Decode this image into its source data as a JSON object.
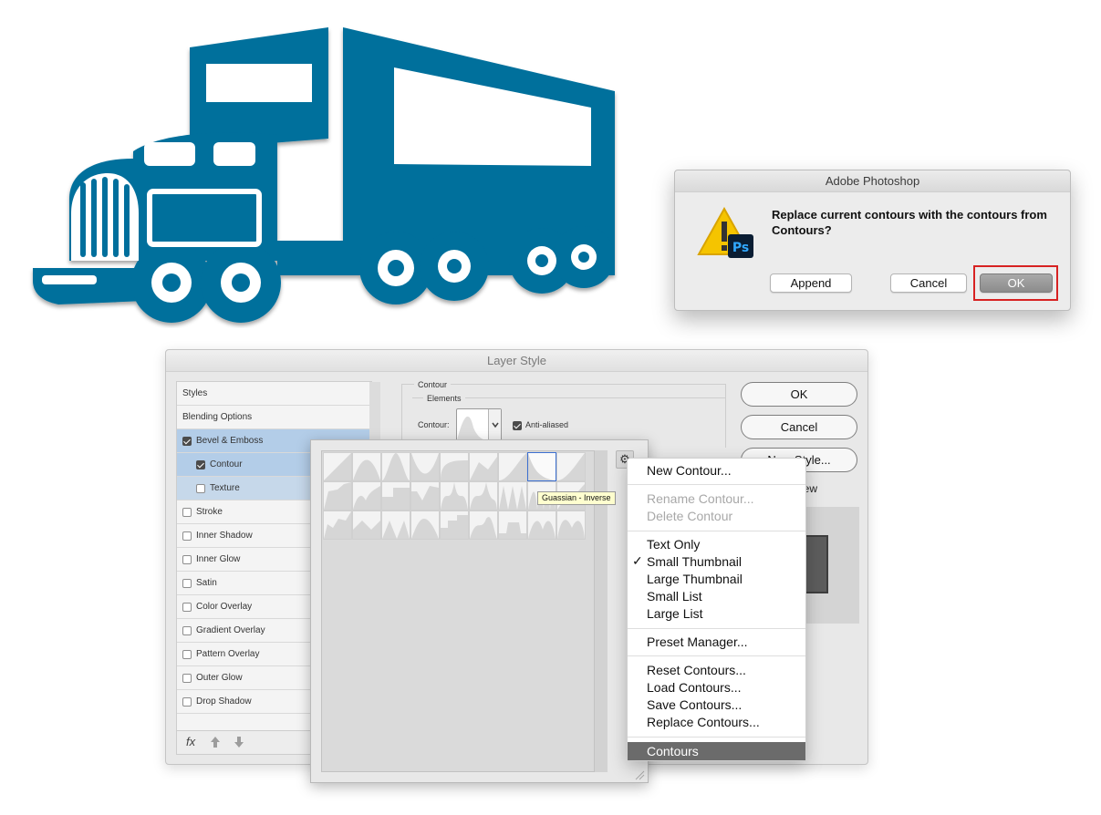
{
  "alert": {
    "title": "Adobe Photoshop",
    "message": "Replace current contours with the contours from Contours?",
    "icon": "warning-photoshop-icon",
    "buttons": {
      "append": "Append",
      "cancel": "Cancel",
      "ok": "OK"
    },
    "highlight_color": "#d72222"
  },
  "layer_style": {
    "title": "Layer Style",
    "styles": [
      {
        "label": "Styles",
        "checkbox": null
      },
      {
        "label": "Blending Options",
        "checkbox": null
      },
      {
        "label": "Bevel & Emboss",
        "checkbox": true,
        "state": "selected"
      },
      {
        "label": "Contour",
        "checkbox": true,
        "state": "sub-selected"
      },
      {
        "label": "Texture",
        "checkbox": false,
        "state": "sub"
      },
      {
        "label": "Stroke",
        "checkbox": false
      },
      {
        "label": "Inner Shadow",
        "checkbox": false
      },
      {
        "label": "Inner Glow",
        "checkbox": false
      },
      {
        "label": "Satin",
        "checkbox": false
      },
      {
        "label": "Color Overlay",
        "checkbox": false
      },
      {
        "label": "Gradient Overlay",
        "checkbox": false
      },
      {
        "label": "Pattern Overlay",
        "checkbox": false
      },
      {
        "label": "Outer Glow",
        "checkbox": false
      },
      {
        "label": "Drop Shadow",
        "checkbox": false
      }
    ],
    "footer": {
      "fx": "fx",
      "icons": [
        "fx-icon",
        "arrow-up-icon",
        "arrow-down-icon"
      ]
    },
    "contour_section": {
      "title": "Contour",
      "elements_title": "Elements",
      "contour_label": "Contour:",
      "anti_aliased_label": "Anti-aliased",
      "anti_aliased": true
    },
    "buttons": {
      "ok": "OK",
      "cancel": "Cancel",
      "new_style": "New Style..."
    },
    "preview_label": "view"
  },
  "picker": {
    "tooltip": "Guassian - Inverse",
    "selected_index": 7,
    "thumb_count": 27,
    "gear_icon": "gear-icon"
  },
  "menu": {
    "items": [
      {
        "label": "New Contour...",
        "enabled": true
      },
      {
        "label": "Rename Contour...",
        "enabled": false
      },
      {
        "label": "Delete Contour",
        "enabled": false
      },
      {
        "label": "Text Only",
        "enabled": true
      },
      {
        "label": "Small Thumbnail",
        "enabled": true,
        "checked": true
      },
      {
        "label": "Large Thumbnail",
        "enabled": true
      },
      {
        "label": "Small List",
        "enabled": true
      },
      {
        "label": "Large List",
        "enabled": true
      },
      {
        "label": "Preset Manager...",
        "enabled": true
      },
      {
        "label": "Reset Contours...",
        "enabled": true
      },
      {
        "label": "Load Contours...",
        "enabled": true
      },
      {
        "label": "Save Contours...",
        "enabled": true
      },
      {
        "label": "Replace Contours...",
        "enabled": true
      },
      {
        "label": "Contours",
        "enabled": true,
        "highlighted": true
      }
    ],
    "check_glyph": "✓"
  },
  "colors": {
    "truck_blue": "#006f9c",
    "menu_highlight": "#6b6b6b",
    "selection_blue": "#b3cde8"
  }
}
